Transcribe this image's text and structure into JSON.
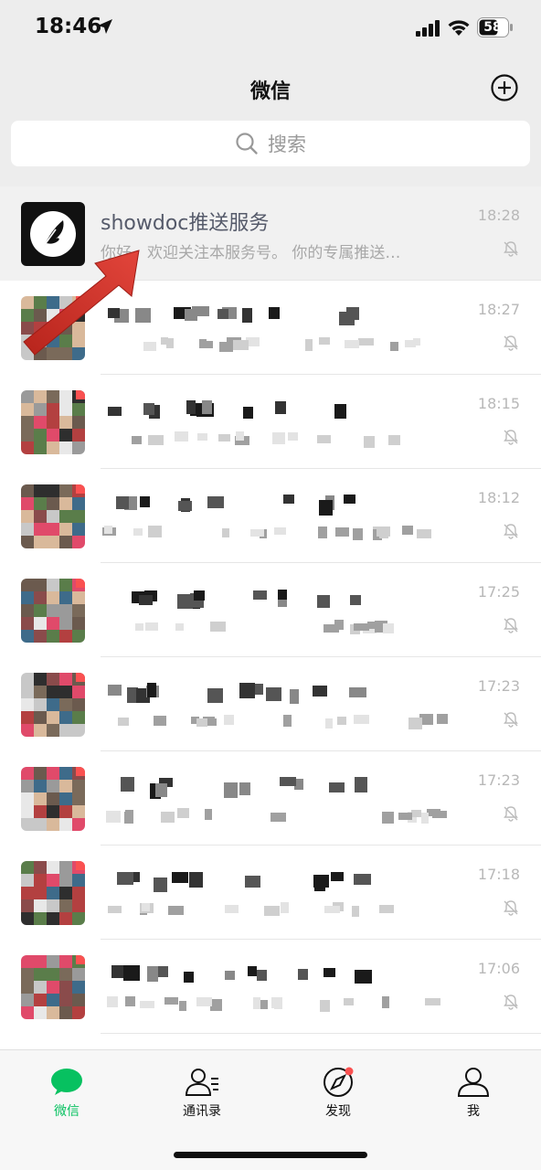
{
  "status_bar": {
    "time": "18:46",
    "battery": "58"
  },
  "nav": {
    "title": "微信"
  },
  "search": {
    "placeholder": "搜索"
  },
  "chats": [
    {
      "name": "showdoc推送服务",
      "preview": "你好，欢迎关注本服务号。 你的专属推送…",
      "time": "18:28"
    },
    {
      "name": "",
      "preview": "",
      "time": "18:27"
    },
    {
      "name": "",
      "preview": "",
      "time": "18:15"
    },
    {
      "name": "",
      "preview": "",
      "time": "18:12"
    },
    {
      "name": "",
      "preview": "",
      "time": "17:25"
    },
    {
      "name": "",
      "preview": "",
      "time": "17:23"
    },
    {
      "name": "",
      "preview": "",
      "time": "17:23"
    },
    {
      "name": "",
      "preview": "",
      "time": "17:18"
    },
    {
      "name": "",
      "preview": "",
      "time": "17:06"
    }
  ],
  "tabs": [
    {
      "label": "微信",
      "icon": "chat-bubble-icon",
      "active": true
    },
    {
      "label": "通讯录",
      "icon": "contacts-icon",
      "active": false
    },
    {
      "label": "发现",
      "icon": "compass-icon",
      "active": false,
      "badge": true
    },
    {
      "label": "我",
      "icon": "person-icon",
      "active": false
    }
  ],
  "colors": {
    "accent": "#07c160",
    "badge": "#fa5151",
    "arrow": "#d9342b"
  }
}
